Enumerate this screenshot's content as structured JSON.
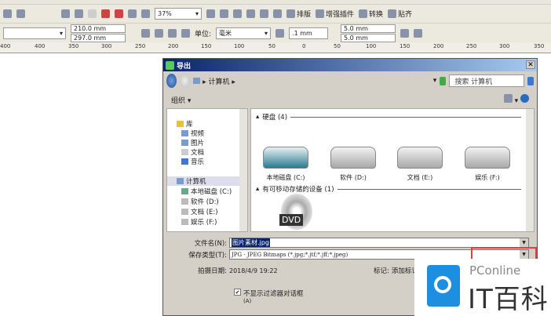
{
  "toolbar": {
    "zoom": "37%",
    "buttons": [
      "排版",
      "增强插件",
      "转换",
      "贴齐"
    ]
  },
  "propbar": {
    "width": "210.0 mm",
    "height": "297.0 mm",
    "unit_label": "单位:",
    "unit": "毫米",
    "nudge": ".1 mm",
    "dup_x": "5.0 mm",
    "dup_y": "5.0 mm"
  },
  "ruler": [
    "400",
    "400",
    "350",
    "300",
    "250",
    "200",
    "150",
    "100",
    "50",
    "0",
    "50",
    "100",
    "150",
    "200",
    "250",
    "300",
    "350"
  ],
  "dialog": {
    "title": "导出",
    "path": "计算机",
    "search_placeholder": "搜索 计算机",
    "organize": "组织",
    "nav": {
      "library": "库",
      "video": "视频",
      "pictures": "图片",
      "documents": "文档",
      "music": "音乐",
      "computer": "计算机",
      "drives": [
        "本地磁盘 (C:)",
        "软件 (D:)",
        "文档 (E:)",
        "娱乐 (F:)"
      ]
    },
    "groups": {
      "hdd": "硬盘 (4)",
      "removable": "有可移动存储的设备 (1)"
    },
    "drives": [
      "本地磁盘 (C:)",
      "软件 (D:)",
      "文档 (E:)",
      "娱乐 (F:)"
    ],
    "dvd_label": "DVD",
    "filename_label": "文件名(N):",
    "filename": "图片素材.jpg",
    "filetype_label": "保存类型(T):",
    "filetype": "JPG - JPEG Bitmaps (*.jpg;*.jtf;*.jff;*.jpeg)",
    "date_label": "拍摄日期:",
    "date": "2018/4/9 19:22",
    "tag_label": "标记:",
    "tag": "添加标记",
    "checkbox_label": "不显示过滤器对话框",
    "checkbox_sub": "(A)",
    "checkbox_checked": true
  },
  "watermark": {
    "brand": "PConline",
    "name": "IT百科"
  }
}
